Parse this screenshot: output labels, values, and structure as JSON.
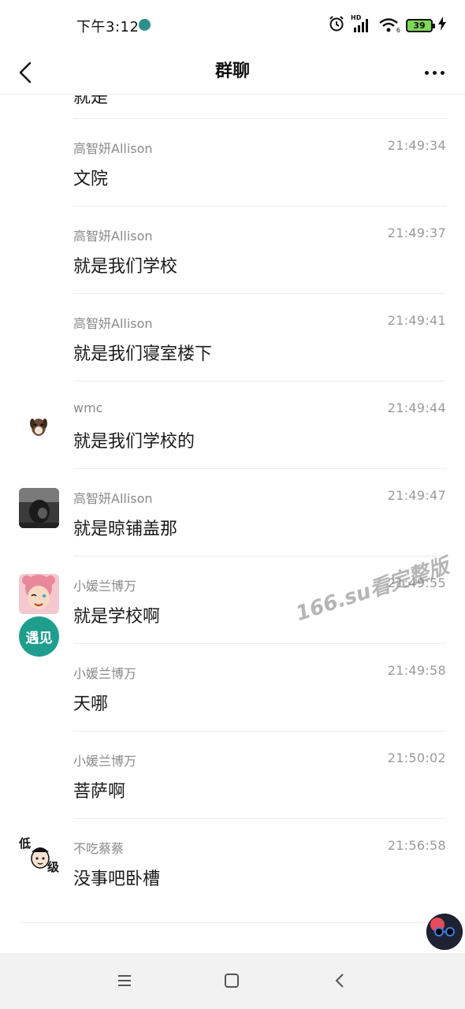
{
  "status_bar": {
    "time": "下午3:12",
    "network_label": "HD",
    "signal_sub": "6",
    "battery_level": "39"
  },
  "nav": {
    "title": "群聊"
  },
  "top_partial_text": "就是",
  "messages": [
    {
      "sender": "高智妍Allison",
      "time": "21:49:34",
      "text": "文院",
      "avatar": "none"
    },
    {
      "sender": "高智妍Allison",
      "time": "21:49:37",
      "text": "就是我们学校",
      "avatar": "none"
    },
    {
      "sender": "高智妍Allison",
      "time": "21:49:41",
      "text": "就是我们寝室楼下",
      "avatar": "none"
    },
    {
      "sender": "wmc",
      "time": "21:49:44",
      "text": "就是我们学校的",
      "avatar": "dog-avatar"
    },
    {
      "sender": "高智妍Allison",
      "time": "21:49:47",
      "text": "就是晾铺盖那",
      "avatar": "photo-avatar"
    },
    {
      "sender": "小媛兰博万",
      "time": "21:49:55",
      "text": "就是学校啊",
      "avatar": "cartoon-girl-avatar"
    },
    {
      "sender": "小媛兰博万",
      "time": "21:49:58",
      "text": "天哪",
      "avatar": "none"
    },
    {
      "sender": "小媛兰博万",
      "time": "21:50:02",
      "text": "菩萨啊",
      "avatar": "none"
    },
    {
      "sender": "不吃蔡蔡",
      "time": "21:56:58",
      "text": "没事吧卧槽",
      "avatar": "low-level-avatar"
    }
  ],
  "stacked_avatar_text": "遇见",
  "low_level_avatar_text": {
    "top": "低",
    "bottom": "级"
  },
  "watermark": "166.su看完整版",
  "colors": {
    "sender": "#8a8a8a",
    "text": "#1a1a1a",
    "divider": "#ececec",
    "battery": "#7ed957",
    "teal_avatar": "#1f9e8e"
  }
}
